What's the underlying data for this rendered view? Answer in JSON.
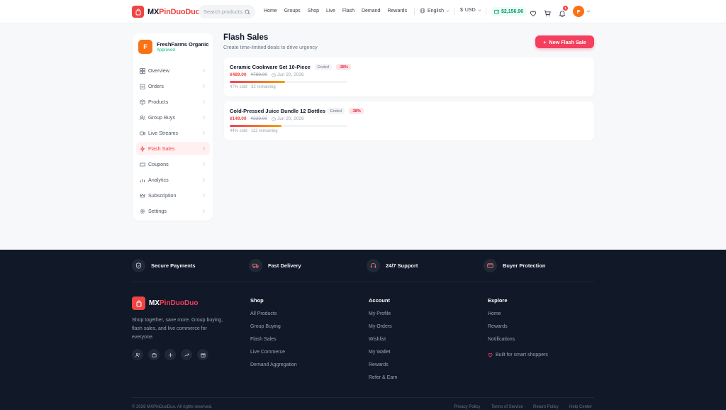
{
  "header": {
    "logo_prefix": "MX",
    "logo_brand": "PinDuoDuo",
    "search_placeholder": "Search products...",
    "nav": [
      "Home",
      "Groups",
      "Shop",
      "Live",
      "Flash",
      "Demand",
      "Rewards"
    ],
    "language": "English",
    "currency_symbol": "$",
    "currency": "USD",
    "wallet_balance": "$2,156.96",
    "notification_count": "1",
    "avatar_initial": "F"
  },
  "sidebar": {
    "store_initial": "F",
    "store_name": "FreshFarms Organic",
    "store_status": "Approved",
    "items": [
      {
        "label": "Overview",
        "icon": "grid-icon"
      },
      {
        "label": "Orders",
        "icon": "clipboard-icon"
      },
      {
        "label": "Products",
        "icon": "box-icon"
      },
      {
        "label": "Group Buys",
        "icon": "users-icon"
      },
      {
        "label": "Live Streams",
        "icon": "video-icon"
      },
      {
        "label": "Flash Sales",
        "icon": "zap-icon"
      },
      {
        "label": "Coupons",
        "icon": "ticket-icon"
      },
      {
        "label": "Analytics",
        "icon": "bar-chart-icon"
      },
      {
        "label": "Subscription",
        "icon": "crown-icon"
      },
      {
        "label": "Settings",
        "icon": "gear-icon"
      }
    ],
    "active_item": "Flash Sales"
  },
  "main": {
    "title": "Flash Sales",
    "subtitle": "Create time-limited deals to drive urgency",
    "new_button": "New Flash Sale",
    "sales": [
      {
        "name": "Ceramic Cookware Set 10-Piece",
        "status": "Ended",
        "discount": "-38%",
        "price": "¥489.00",
        "original_price": "¥789.00",
        "date": "Jun 20, 2026",
        "sold_fraction": 0.47,
        "sold_text": "47% sold · 32 remaining"
      },
      {
        "name": "Cold-Pressed Juice Bundle 12 Bottles",
        "status": "Ended",
        "discount": "-38%",
        "price": "¥149.00",
        "original_price": "¥239.00",
        "date": "Jun 20, 2026",
        "sold_fraction": 0.44,
        "sold_text": "44% sold · 112 remaining"
      }
    ]
  },
  "footer": {
    "features": [
      "Secure Payments",
      "Fast Delivery",
      "24/7 Support",
      "Buyer Protection"
    ],
    "logo_prefix": "MX",
    "logo_brand": "PinDuoDuo",
    "description": "Shop together, save more. Group buying, flash sales, and live commerce for everyone.",
    "columns": [
      {
        "title": "Shop",
        "links": [
          "All Products",
          "Group Buying",
          "Flash Sales",
          "Live Commerce",
          "Demand Aggregation"
        ]
      },
      {
        "title": "Account",
        "links": [
          "My Profile",
          "My Orders",
          "Wishlist",
          "My Wallet",
          "Rewards",
          "Refer & Earn"
        ]
      },
      {
        "title": "Explore",
        "links": [
          "Home",
          "Rewards",
          "Notifications"
        ]
      }
    ],
    "built_for": "Built for smart shoppers",
    "copyright": "© 2026 MXPinDuoDuo. All rights reserved.",
    "legal_links": [
      "Privacy Policy",
      "Terms of Service",
      "Return Policy",
      "Help Center"
    ]
  },
  "colors": {
    "accent": "#f43f5e",
    "brand_red": "#ef4444",
    "success": "#10b981",
    "footer_bg": "#111827"
  }
}
